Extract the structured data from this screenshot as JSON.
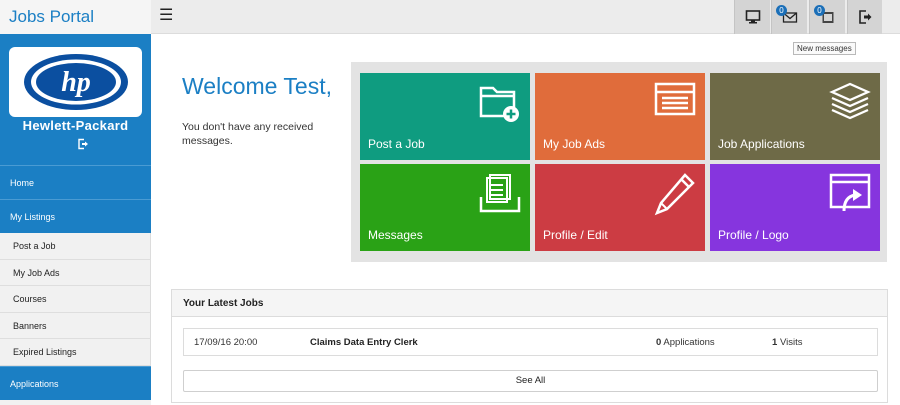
{
  "app": {
    "title": "Jobs Portal"
  },
  "topbar": {
    "messages_badge": "0",
    "applications_badge": "0",
    "tooltip": "New messages"
  },
  "sidebar": {
    "company": "Hewlett-Packard",
    "logo_text": "hp",
    "items": [
      {
        "label": "Home",
        "type": "main"
      },
      {
        "label": "My Listings",
        "type": "main"
      },
      {
        "label": "Post a Job",
        "type": "sub"
      },
      {
        "label": "My Job Ads",
        "type": "sub"
      },
      {
        "label": "Courses",
        "type": "sub"
      },
      {
        "label": "Banners",
        "type": "sub"
      },
      {
        "label": "Expired Listings",
        "type": "sub"
      },
      {
        "label": "Applications",
        "type": "main"
      }
    ]
  },
  "main": {
    "welcome": "Welcome Test,",
    "no_messages": "You don't have any received messages."
  },
  "tiles": [
    {
      "label": "Post a Job",
      "color": "#0f9c80",
      "icon": "folder-add-icon"
    },
    {
      "label": "My Job Ads",
      "color": "#e06c3b",
      "icon": "list-icon"
    },
    {
      "label": "Job Applications",
      "color": "#6e6a47",
      "icon": "stack-icon"
    },
    {
      "label": "Messages",
      "color": "#2aa216",
      "icon": "inbox-icon"
    },
    {
      "label": "Profile / Edit",
      "color": "#cc3c43",
      "icon": "pencil-icon"
    },
    {
      "label": "Profile / Logo",
      "color": "#8635de",
      "icon": "upload-window-icon"
    }
  ],
  "latest_jobs": {
    "title": "Your Latest Jobs",
    "rows": [
      {
        "date": "17/09/16 20:00",
        "title": "Claims Data Entry Clerk",
        "applications_count": "0",
        "applications_label": "Applications",
        "visits_count": "1",
        "visits_label": "Visits"
      }
    ],
    "see_all": "See All"
  }
}
